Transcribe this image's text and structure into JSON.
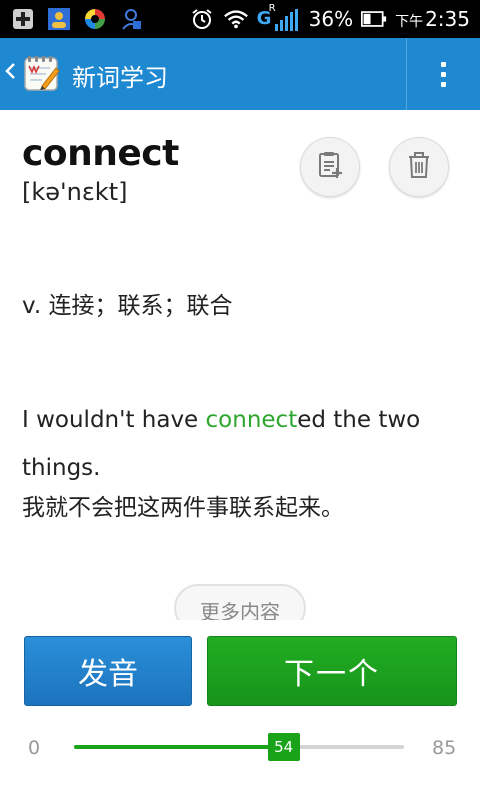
{
  "status_bar": {
    "signal_label": "G",
    "signal_sub": "R",
    "battery_percent": "36%",
    "time_ampm": "下午",
    "time": "2:35",
    "icons": [
      "plus-square-icon",
      "contacts-icon",
      "sync-app-icon",
      "alarm-person-icon",
      "alarm-clock-icon",
      "wifi-icon",
      "signal-icon",
      "battery-icon"
    ]
  },
  "app_bar": {
    "title": "新词学习",
    "back_icon": "chevron-left-icon",
    "menu_icon": "overflow-menu-icon",
    "color": "#1e88d1"
  },
  "word": {
    "text": "connect",
    "phonetic": "[kə'nɛkt]",
    "definition": "v. 连接；联系；联合",
    "example_before": "I wouldn't have ",
    "example_highlight": "connect",
    "example_after": "ed the two things.",
    "example_translation": "我就不会把这两件事联系起来。",
    "highlight_color": "#2ea62e"
  },
  "actions": {
    "add_note_icon": "note-add-icon",
    "delete_icon": "trash-icon",
    "more_label": "更多内容",
    "pronounce_label": "发音",
    "next_label": "下一个"
  },
  "progress": {
    "min": "0",
    "max": "85",
    "current": "54",
    "value": 54,
    "total": 85,
    "color": "#19a319"
  }
}
